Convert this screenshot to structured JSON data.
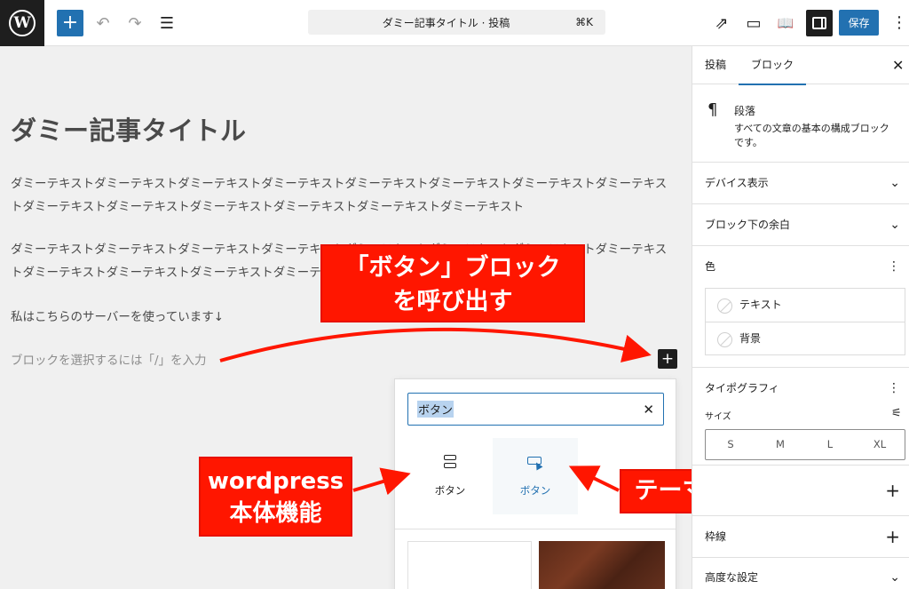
{
  "toolbar": {
    "logo_letter": "W",
    "add_symbol": "+",
    "undo_symbol": "↶",
    "redo_symbol": "↷",
    "outline_symbol": "☰",
    "command_title": "ダミー記事タイトル · 投稿",
    "command_shortcut": "⌘K",
    "view_external_symbol": "⇗",
    "preview_symbol": "▭",
    "learn_symbol": "📖",
    "save_label": "保存",
    "more_symbol": "⋮"
  },
  "editor": {
    "title": "ダミー記事タイトル",
    "paragraph1": "ダミーテキストダミーテキストダミーテキストダミーテキストダミーテキストダミーテキストダミーテキストダミーテキストダミーテキストダミーテキストダミーテキストダミーテキストダミーテキストダミーテキスト",
    "paragraph2": "ダミーテキストダミーテキストダミーテキストダミーテキストダミーテキストダミーテキストダミーテキストダミーテキストダミーテキストダミーテキストダミーテキストダミーテキスト",
    "paragraph3": "私はこちらのサーバーを使っています↓",
    "placeholder": "ブロックを選択するには「/」を入力",
    "insert_symbol": "+"
  },
  "inserter": {
    "search_value": "ボタン",
    "clear_symbol": "✕",
    "results": [
      {
        "label": "ボタン",
        "icon": "buttons-icon"
      },
      {
        "label": "ボタン",
        "icon": "theme-button-icon"
      }
    ]
  },
  "callouts": {
    "top_line1": "「ボタン」ブロック",
    "top_line2": "を呼び出す",
    "left_line1": "wordpress",
    "left_line2": "本体機能",
    "right": "テーマ機能"
  },
  "sidebar": {
    "tab_post": "投稿",
    "tab_block": "ブロック",
    "close_symbol": "✕",
    "block_name": "段落",
    "block_description": "すべての文章の基本の構成ブロックです。",
    "pilcrow": "¶",
    "panel_device": "デバイス表示",
    "panel_margin": "ブロック下の余白",
    "panel_color": "色",
    "color_text": "テキスト",
    "color_background": "背景",
    "panel_typography": "タイポグラフィ",
    "size_label": "サイズ",
    "sizes": [
      "S",
      "M",
      "L",
      "XL"
    ],
    "panel_border": "枠線",
    "panel_advanced": "高度な設定",
    "chevron": "⌄",
    "plus": "+",
    "kebab": "⋮"
  },
  "colors": {
    "accent": "#2271b1",
    "callout": "#ff1600",
    "dark": "#1e1e1e"
  }
}
